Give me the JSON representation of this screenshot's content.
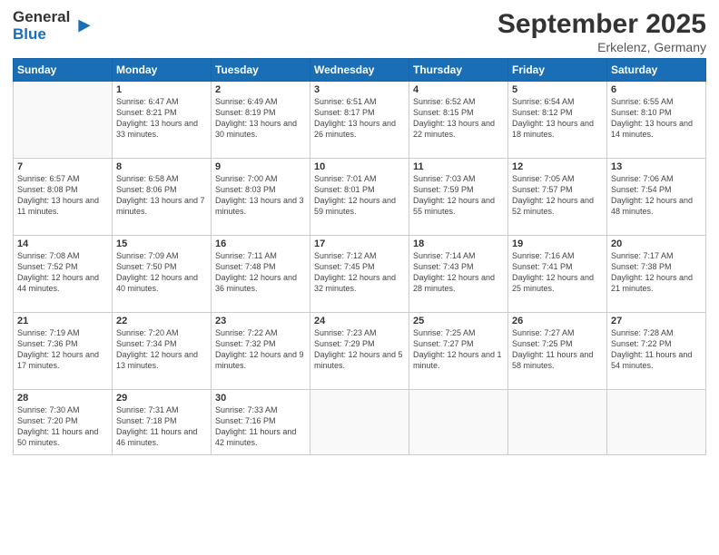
{
  "logo": {
    "general": "General",
    "blue": "Blue"
  },
  "title": "September 2025",
  "location": "Erkelenz, Germany",
  "days_of_week": [
    "Sunday",
    "Monday",
    "Tuesday",
    "Wednesday",
    "Thursday",
    "Friday",
    "Saturday"
  ],
  "weeks": [
    [
      {
        "num": "",
        "info": ""
      },
      {
        "num": "1",
        "info": "Sunrise: 6:47 AM\nSunset: 8:21 PM\nDaylight: 13 hours and 33 minutes."
      },
      {
        "num": "2",
        "info": "Sunrise: 6:49 AM\nSunset: 8:19 PM\nDaylight: 13 hours and 30 minutes."
      },
      {
        "num": "3",
        "info": "Sunrise: 6:51 AM\nSunset: 8:17 PM\nDaylight: 13 hours and 26 minutes."
      },
      {
        "num": "4",
        "info": "Sunrise: 6:52 AM\nSunset: 8:15 PM\nDaylight: 13 hours and 22 minutes."
      },
      {
        "num": "5",
        "info": "Sunrise: 6:54 AM\nSunset: 8:12 PM\nDaylight: 13 hours and 18 minutes."
      },
      {
        "num": "6",
        "info": "Sunrise: 6:55 AM\nSunset: 8:10 PM\nDaylight: 13 hours and 14 minutes."
      }
    ],
    [
      {
        "num": "7",
        "info": "Sunrise: 6:57 AM\nSunset: 8:08 PM\nDaylight: 13 hours and 11 minutes."
      },
      {
        "num": "8",
        "info": "Sunrise: 6:58 AM\nSunset: 8:06 PM\nDaylight: 13 hours and 7 minutes."
      },
      {
        "num": "9",
        "info": "Sunrise: 7:00 AM\nSunset: 8:03 PM\nDaylight: 13 hours and 3 minutes."
      },
      {
        "num": "10",
        "info": "Sunrise: 7:01 AM\nSunset: 8:01 PM\nDaylight: 12 hours and 59 minutes."
      },
      {
        "num": "11",
        "info": "Sunrise: 7:03 AM\nSunset: 7:59 PM\nDaylight: 12 hours and 55 minutes."
      },
      {
        "num": "12",
        "info": "Sunrise: 7:05 AM\nSunset: 7:57 PM\nDaylight: 12 hours and 52 minutes."
      },
      {
        "num": "13",
        "info": "Sunrise: 7:06 AM\nSunset: 7:54 PM\nDaylight: 12 hours and 48 minutes."
      }
    ],
    [
      {
        "num": "14",
        "info": "Sunrise: 7:08 AM\nSunset: 7:52 PM\nDaylight: 12 hours and 44 minutes."
      },
      {
        "num": "15",
        "info": "Sunrise: 7:09 AM\nSunset: 7:50 PM\nDaylight: 12 hours and 40 minutes."
      },
      {
        "num": "16",
        "info": "Sunrise: 7:11 AM\nSunset: 7:48 PM\nDaylight: 12 hours and 36 minutes."
      },
      {
        "num": "17",
        "info": "Sunrise: 7:12 AM\nSunset: 7:45 PM\nDaylight: 12 hours and 32 minutes."
      },
      {
        "num": "18",
        "info": "Sunrise: 7:14 AM\nSunset: 7:43 PM\nDaylight: 12 hours and 28 minutes."
      },
      {
        "num": "19",
        "info": "Sunrise: 7:16 AM\nSunset: 7:41 PM\nDaylight: 12 hours and 25 minutes."
      },
      {
        "num": "20",
        "info": "Sunrise: 7:17 AM\nSunset: 7:38 PM\nDaylight: 12 hours and 21 minutes."
      }
    ],
    [
      {
        "num": "21",
        "info": "Sunrise: 7:19 AM\nSunset: 7:36 PM\nDaylight: 12 hours and 17 minutes."
      },
      {
        "num": "22",
        "info": "Sunrise: 7:20 AM\nSunset: 7:34 PM\nDaylight: 12 hours and 13 minutes."
      },
      {
        "num": "23",
        "info": "Sunrise: 7:22 AM\nSunset: 7:32 PM\nDaylight: 12 hours and 9 minutes."
      },
      {
        "num": "24",
        "info": "Sunrise: 7:23 AM\nSunset: 7:29 PM\nDaylight: 12 hours and 5 minutes."
      },
      {
        "num": "25",
        "info": "Sunrise: 7:25 AM\nSunset: 7:27 PM\nDaylight: 12 hours and 1 minute."
      },
      {
        "num": "26",
        "info": "Sunrise: 7:27 AM\nSunset: 7:25 PM\nDaylight: 11 hours and 58 minutes."
      },
      {
        "num": "27",
        "info": "Sunrise: 7:28 AM\nSunset: 7:22 PM\nDaylight: 11 hours and 54 minutes."
      }
    ],
    [
      {
        "num": "28",
        "info": "Sunrise: 7:30 AM\nSunset: 7:20 PM\nDaylight: 11 hours and 50 minutes."
      },
      {
        "num": "29",
        "info": "Sunrise: 7:31 AM\nSunset: 7:18 PM\nDaylight: 11 hours and 46 minutes."
      },
      {
        "num": "30",
        "info": "Sunrise: 7:33 AM\nSunset: 7:16 PM\nDaylight: 11 hours and 42 minutes."
      },
      {
        "num": "",
        "info": ""
      },
      {
        "num": "",
        "info": ""
      },
      {
        "num": "",
        "info": ""
      },
      {
        "num": "",
        "info": ""
      }
    ]
  ]
}
